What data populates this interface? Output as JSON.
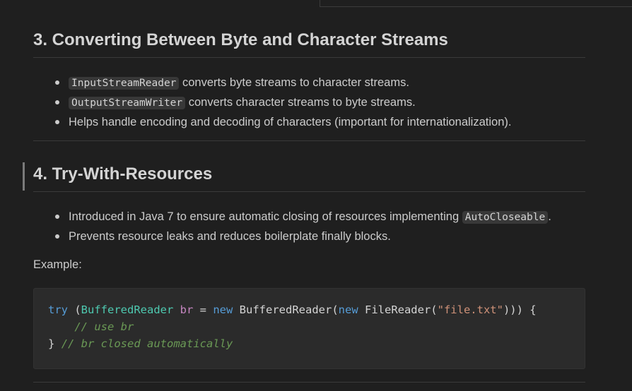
{
  "section3": {
    "heading": "3. Converting Between Byte and Character Streams",
    "bullets": [
      {
        "code": "InputStreamReader",
        "text": " converts byte streams to character streams."
      },
      {
        "code": "OutputStreamWriter",
        "text": " converts character streams to byte streams."
      },
      {
        "text": "Helps handle encoding and decoding of characters (important for internationalization)."
      }
    ]
  },
  "section4": {
    "heading": "4. Try-With-Resources",
    "bullets": [
      {
        "text": "Introduced in Java 7 to ensure automatic closing of resources implementing ",
        "code": "AutoCloseable",
        "suffix": "."
      },
      {
        "text": "Prevents resource leaks and reduces boilerplate finally blocks."
      }
    ],
    "example_label": "Example:",
    "code": {
      "line1": {
        "try": "try",
        "open": " (",
        "type1": "BufferedReader",
        "sp1": " ",
        "var": "br",
        "eq": " = ",
        "new1": "new",
        "ctor1": " BufferedReader(",
        "new2": "new",
        "ctor2": " FileReader(",
        "str": "\"file.txt\"",
        "close": "))) {"
      },
      "line2_comment": "// use br",
      "line3_brace": "}",
      "line3_comment": "// br closed automatically"
    }
  }
}
